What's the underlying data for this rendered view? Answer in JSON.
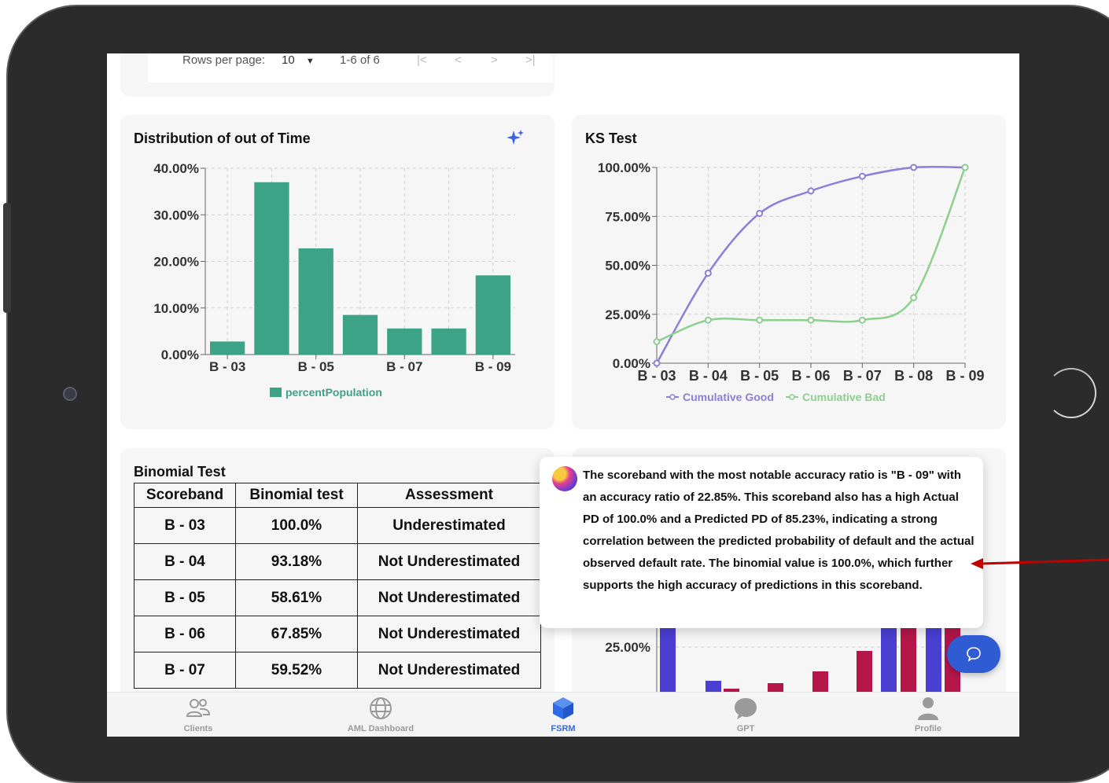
{
  "pagination": {
    "rows_per_page_label": "Rows per page:",
    "rows_per_page_value": "10",
    "range": "1-6 of 6"
  },
  "distribution_card": {
    "title": "Distribution of out of Time",
    "sparkle_icon": "sparkle-icon",
    "bar_color": "#3da386"
  },
  "ks_card": {
    "title": "KS Test",
    "good_color": "#8d7ed9",
    "bad_color": "#8ccf8e"
  },
  "binomial_card": {
    "title": "Binomial Test",
    "headers": [
      "Scoreband",
      "Binomial test",
      "Assessment"
    ],
    "rows": [
      {
        "scoreband": "B - 03",
        "binomial": "100.0%",
        "assessment": "Underestimated"
      },
      {
        "scoreband": "B - 04",
        "binomial": "93.18%",
        "assessment": "Not Underestimated"
      },
      {
        "scoreband": "B - 05",
        "binomial": "58.61%",
        "assessment": "Not Underestimated"
      },
      {
        "scoreband": "B - 06",
        "binomial": "67.85%",
        "assessment": "Not Underestimated"
      },
      {
        "scoreband": "B - 07",
        "binomial": "59.52%",
        "assessment": "Not Underestimated"
      }
    ]
  },
  "accuracy_card": {
    "tick_25": "25.00%",
    "bar_colors": [
      "#4b3fd1",
      "#b4164a"
    ]
  },
  "tooltip": {
    "text": "The scoreband with the most notable accuracy ratio is \"B - 09\" with an accuracy ratio of 22.85%. This scoreband also has a high Actual PD of 100.0% and a Predicted PD of 85.23%, indicating a strong correlation between the predicted probability of default and the actual observed default rate. The binomial value is 100.0%, which further supports the high accuracy of predictions in this scoreband."
  },
  "annotation_arrow_color": "#c00000",
  "nav": [
    {
      "label": "Clients",
      "icon": "users-icon",
      "active": false
    },
    {
      "label": "AML Dashboard",
      "icon": "globe-icon",
      "active": false
    },
    {
      "label": "FSRM",
      "icon": "cube-icon",
      "active": true
    },
    {
      "label": "GPT",
      "icon": "chat-bubble-icon",
      "active": false
    },
    {
      "label": "Profile",
      "icon": "person-icon",
      "active": false
    }
  ],
  "chart_data": [
    {
      "type": "bar",
      "title": "Distribution of out of Time",
      "categories": [
        "B - 03",
        "B - 04",
        "B - 05",
        "B - 06",
        "B - 07",
        "B - 08",
        "B - 09"
      ],
      "x_tick_labels": [
        "B - 03",
        "B - 05",
        "B - 07",
        "B - 09"
      ],
      "series": [
        {
          "name": "percentPopulation",
          "values": [
            2.8,
            37.0,
            22.8,
            8.5,
            5.6,
            5.6,
            17.0
          ]
        }
      ],
      "ylim": [
        0,
        40
      ],
      "y_ticks": [
        "0.00%",
        "10.00%",
        "20.00%",
        "30.00%",
        "40.00%"
      ],
      "grid": true,
      "legend": "bottom"
    },
    {
      "type": "line",
      "title": "KS Test",
      "categories": [
        "B - 03",
        "B - 04",
        "B - 05",
        "B - 06",
        "B - 07",
        "B - 08",
        "B - 09"
      ],
      "series": [
        {
          "name": "Cumulative Good",
          "values": [
            0.0,
            46.0,
            76.5,
            88.0,
            95.5,
            100.0,
            100.0
          ]
        },
        {
          "name": "Cumulative Bad",
          "values": [
            11.0,
            22.0,
            22.0,
            22.0,
            22.0,
            33.5,
            100.0
          ]
        }
      ],
      "ylim": [
        0,
        100
      ],
      "y_ticks": [
        "0.00%",
        "25.00%",
        "50.00%",
        "75.00%",
        "100.00%"
      ],
      "grid": true,
      "legend": "bottom"
    }
  ]
}
